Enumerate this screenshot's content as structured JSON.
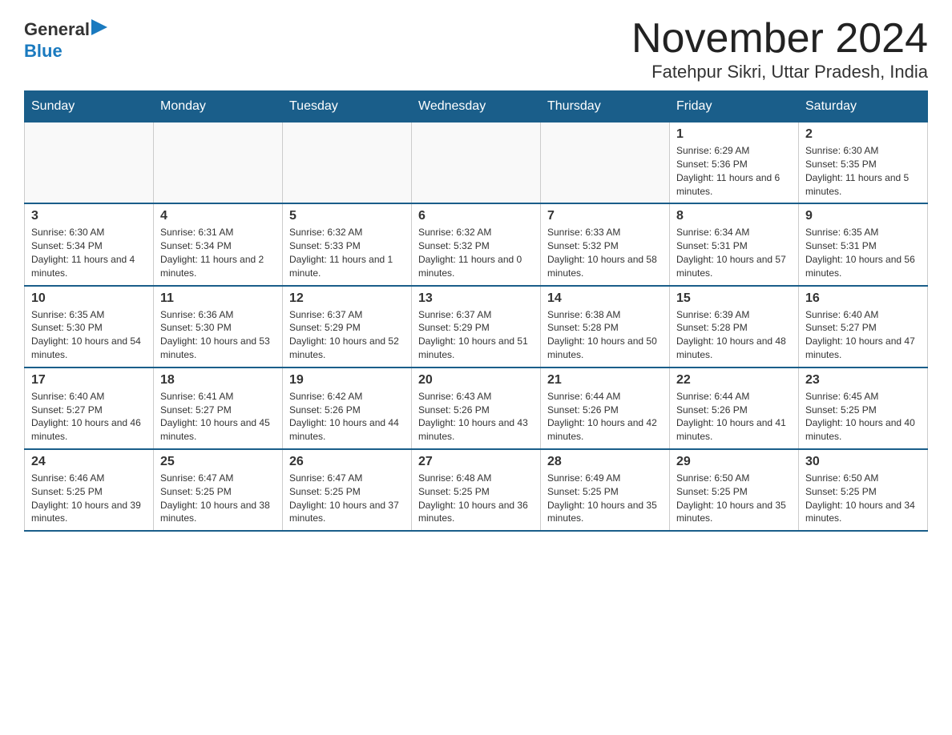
{
  "logo": {
    "general": "General",
    "blue": "Blue",
    "arrow": "▶"
  },
  "title": "November 2024",
  "subtitle": "Fatehpur Sikri, Uttar Pradesh, India",
  "days_header": [
    "Sunday",
    "Monday",
    "Tuesday",
    "Wednesday",
    "Thursday",
    "Friday",
    "Saturday"
  ],
  "weeks": [
    [
      {
        "day": "",
        "info": ""
      },
      {
        "day": "",
        "info": ""
      },
      {
        "day": "",
        "info": ""
      },
      {
        "day": "",
        "info": ""
      },
      {
        "day": "",
        "info": ""
      },
      {
        "day": "1",
        "info": "Sunrise: 6:29 AM\nSunset: 5:36 PM\nDaylight: 11 hours and 6 minutes."
      },
      {
        "day": "2",
        "info": "Sunrise: 6:30 AM\nSunset: 5:35 PM\nDaylight: 11 hours and 5 minutes."
      }
    ],
    [
      {
        "day": "3",
        "info": "Sunrise: 6:30 AM\nSunset: 5:34 PM\nDaylight: 11 hours and 4 minutes."
      },
      {
        "day": "4",
        "info": "Sunrise: 6:31 AM\nSunset: 5:34 PM\nDaylight: 11 hours and 2 minutes."
      },
      {
        "day": "5",
        "info": "Sunrise: 6:32 AM\nSunset: 5:33 PM\nDaylight: 11 hours and 1 minute."
      },
      {
        "day": "6",
        "info": "Sunrise: 6:32 AM\nSunset: 5:32 PM\nDaylight: 11 hours and 0 minutes."
      },
      {
        "day": "7",
        "info": "Sunrise: 6:33 AM\nSunset: 5:32 PM\nDaylight: 10 hours and 58 minutes."
      },
      {
        "day": "8",
        "info": "Sunrise: 6:34 AM\nSunset: 5:31 PM\nDaylight: 10 hours and 57 minutes."
      },
      {
        "day": "9",
        "info": "Sunrise: 6:35 AM\nSunset: 5:31 PM\nDaylight: 10 hours and 56 minutes."
      }
    ],
    [
      {
        "day": "10",
        "info": "Sunrise: 6:35 AM\nSunset: 5:30 PM\nDaylight: 10 hours and 54 minutes."
      },
      {
        "day": "11",
        "info": "Sunrise: 6:36 AM\nSunset: 5:30 PM\nDaylight: 10 hours and 53 minutes."
      },
      {
        "day": "12",
        "info": "Sunrise: 6:37 AM\nSunset: 5:29 PM\nDaylight: 10 hours and 52 minutes."
      },
      {
        "day": "13",
        "info": "Sunrise: 6:37 AM\nSunset: 5:29 PM\nDaylight: 10 hours and 51 minutes."
      },
      {
        "day": "14",
        "info": "Sunrise: 6:38 AM\nSunset: 5:28 PM\nDaylight: 10 hours and 50 minutes."
      },
      {
        "day": "15",
        "info": "Sunrise: 6:39 AM\nSunset: 5:28 PM\nDaylight: 10 hours and 48 minutes."
      },
      {
        "day": "16",
        "info": "Sunrise: 6:40 AM\nSunset: 5:27 PM\nDaylight: 10 hours and 47 minutes."
      }
    ],
    [
      {
        "day": "17",
        "info": "Sunrise: 6:40 AM\nSunset: 5:27 PM\nDaylight: 10 hours and 46 minutes."
      },
      {
        "day": "18",
        "info": "Sunrise: 6:41 AM\nSunset: 5:27 PM\nDaylight: 10 hours and 45 minutes."
      },
      {
        "day": "19",
        "info": "Sunrise: 6:42 AM\nSunset: 5:26 PM\nDaylight: 10 hours and 44 minutes."
      },
      {
        "day": "20",
        "info": "Sunrise: 6:43 AM\nSunset: 5:26 PM\nDaylight: 10 hours and 43 minutes."
      },
      {
        "day": "21",
        "info": "Sunrise: 6:44 AM\nSunset: 5:26 PM\nDaylight: 10 hours and 42 minutes."
      },
      {
        "day": "22",
        "info": "Sunrise: 6:44 AM\nSunset: 5:26 PM\nDaylight: 10 hours and 41 minutes."
      },
      {
        "day": "23",
        "info": "Sunrise: 6:45 AM\nSunset: 5:25 PM\nDaylight: 10 hours and 40 minutes."
      }
    ],
    [
      {
        "day": "24",
        "info": "Sunrise: 6:46 AM\nSunset: 5:25 PM\nDaylight: 10 hours and 39 minutes."
      },
      {
        "day": "25",
        "info": "Sunrise: 6:47 AM\nSunset: 5:25 PM\nDaylight: 10 hours and 38 minutes."
      },
      {
        "day": "26",
        "info": "Sunrise: 6:47 AM\nSunset: 5:25 PM\nDaylight: 10 hours and 37 minutes."
      },
      {
        "day": "27",
        "info": "Sunrise: 6:48 AM\nSunset: 5:25 PM\nDaylight: 10 hours and 36 minutes."
      },
      {
        "day": "28",
        "info": "Sunrise: 6:49 AM\nSunset: 5:25 PM\nDaylight: 10 hours and 35 minutes."
      },
      {
        "day": "29",
        "info": "Sunrise: 6:50 AM\nSunset: 5:25 PM\nDaylight: 10 hours and 35 minutes."
      },
      {
        "day": "30",
        "info": "Sunrise: 6:50 AM\nSunset: 5:25 PM\nDaylight: 10 hours and 34 minutes."
      }
    ]
  ]
}
